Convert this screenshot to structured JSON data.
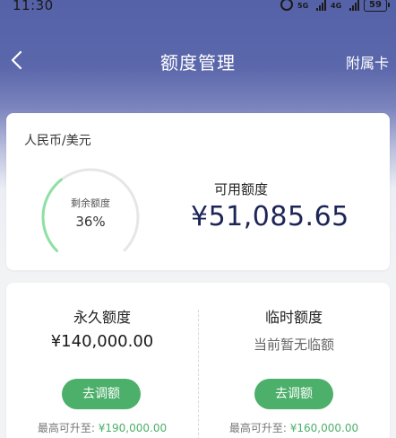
{
  "status_bar": {
    "time": "11:30",
    "network": "5G",
    "network2": "4G",
    "battery": "59"
  },
  "nav": {
    "title": "额度管理",
    "right_label": "附属卡",
    "back_icon": "chevron-left-icon"
  },
  "summary": {
    "currency": "人民币/美元",
    "ring_label": "剩余额度",
    "ring_percent": "36%",
    "ring_fraction": 0.36,
    "available_label": "可用额度",
    "available_amount": "¥51,085.65"
  },
  "permanent": {
    "title": "永久额度",
    "amount": "¥140,000.00",
    "button": "去调额",
    "max_label": "最高可升至:",
    "max_value": "¥190,000.00"
  },
  "temporary": {
    "title": "临时额度",
    "status": "当前暂无临额",
    "button": "去调额",
    "max_label": "最高可升至:",
    "max_value": "¥160,000.00"
  },
  "colors": {
    "header": "#5562a8",
    "accent_green": "#4caf6a",
    "amount_navy": "#1d2556"
  }
}
